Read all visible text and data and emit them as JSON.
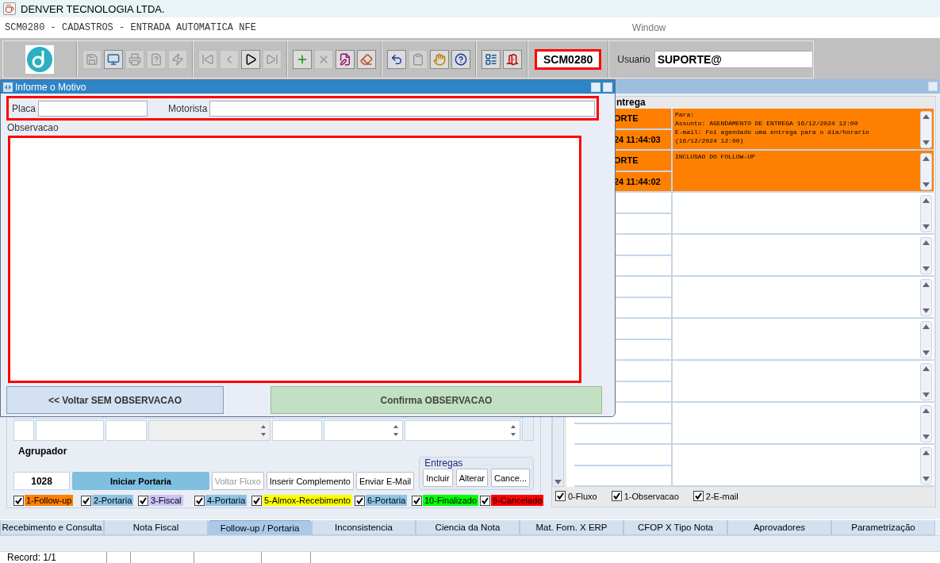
{
  "window": {
    "title": "DENVER TECNOLOGIA LTDA."
  },
  "menu_bar": {
    "title": "SCM0280 - CADASTROS - ENTRADA AUTOMATICA NFE",
    "window_menu": "Window"
  },
  "toolbar": {
    "groups": [
      [
        {
          "kind": "save",
          "disabled": true
        },
        {
          "kind": "window",
          "disabled": false
        },
        {
          "kind": "print",
          "disabled": true
        },
        {
          "kind": "query",
          "disabled": true
        },
        {
          "kind": "execute",
          "disabled": true
        }
      ],
      [
        {
          "kind": "first",
          "disabled": true
        },
        {
          "kind": "prev",
          "disabled": true
        },
        {
          "kind": "next",
          "disabled": false
        },
        {
          "kind": "last",
          "disabled": true
        }
      ],
      [
        {
          "kind": "insert",
          "disabled": false
        },
        {
          "kind": "delete",
          "disabled": true
        },
        {
          "kind": "edit",
          "disabled": false
        },
        {
          "kind": "clear",
          "disabled": false
        }
      ],
      [
        {
          "kind": "undo",
          "disabled": false
        },
        {
          "kind": "clipboard",
          "disabled": true
        },
        {
          "kind": "hand",
          "disabled": false
        },
        {
          "kind": "help",
          "disabled": false
        }
      ],
      [
        {
          "kind": "menu",
          "disabled": false
        },
        {
          "kind": "exit",
          "disabled": false
        }
      ]
    ],
    "screen_code": "SCM0280",
    "user_label": "Usuario",
    "user_value": "SUPORTE@"
  },
  "dialog": {
    "title": "Informe o Motivo",
    "placa_label": "Placa",
    "motorista_label": "Motorista",
    "observacao_label": "Observacao",
    "back_button": "<< Voltar SEM OBSERVACAO",
    "confirm_button": "Confirma OBSERVACAO"
  },
  "portaria": {
    "agrupador_label": "Agrupador",
    "agrupador_value": "1028",
    "buttons": [
      {
        "label": "Iniciar Portaria",
        "kind": "primary",
        "disabled": false
      },
      {
        "label": "Voltar Fluxo",
        "kind": "plain",
        "disabled": true
      },
      {
        "label": "Inserir Complemento",
        "kind": "plain",
        "disabled": false
      },
      {
        "label": "Enviar E-Mail",
        "kind": "plain",
        "disabled": false
      }
    ],
    "entregas": {
      "title": "Entregas",
      "buttons": [
        "Incluir",
        "Alterar",
        "Cance..."
      ]
    },
    "legend": [
      {
        "label": "1-Follow-up",
        "checked": true,
        "color": "#ff8000"
      },
      {
        "label": "2-Portaria",
        "checked": true,
        "color": "#8fc3e6"
      },
      {
        "label": "3-Fiscal",
        "checked": true,
        "color": "#c9c3f7"
      },
      {
        "label": "4-Portaria",
        "checked": true,
        "color": "#8fc3e6"
      },
      {
        "label": "5-Almox-Recebimento",
        "checked": true,
        "color": "#ffff00"
      },
      {
        "label": "6-Portaria",
        "checked": true,
        "color": "#8fc3e6"
      },
      {
        "label": "10-Finalizado",
        "checked": true,
        "color": "#00ff00"
      },
      {
        "label": "9-Cancelado",
        "checked": true,
        "color": "#ff0000"
      }
    ]
  },
  "entrega": {
    "title": "ntrega",
    "rows": [
      {
        "user": "ORTE",
        "datetime": "24 11:44:03",
        "message": [
          "Para:",
          "Assunto: AGENDAMENTO DE ENTREGA 16/12/2024 12:00",
          "E-mail: Foi agendado uma entrega para o dia/horario",
          "(16/12/2024 12:00)"
        ],
        "color": "#ff8000"
      },
      {
        "user": "ORTE",
        "datetime": "24 11:44:02",
        "message": [
          "INCLUSAO DO FOLLOW-UP"
        ],
        "color": "#ff8000"
      },
      {
        "color": "#ffffff"
      },
      {
        "color": "#ffffff"
      },
      {
        "color": "#ffffff"
      },
      {
        "color": "#ffffff"
      },
      {
        "color": "#ffffff"
      },
      {
        "color": "#ffffff"
      },
      {
        "color": "#ffffff"
      }
    ],
    "filters": [
      {
        "label": "0-Fluxo",
        "checked": true
      },
      {
        "label": "1-Observacao",
        "checked": true
      },
      {
        "label": "2-E-mail",
        "checked": true
      }
    ]
  },
  "tabs": [
    {
      "label": "Recebimento e Consulta",
      "selected": false
    },
    {
      "label": "Nota Fiscal",
      "selected": false
    },
    {
      "label": "Follow-up / Portaria",
      "selected": true
    },
    {
      "label": "Inconsistencia",
      "selected": false
    },
    {
      "label": "Ciencia da Nota",
      "selected": false
    },
    {
      "label": "Mat. Forn. X ERP",
      "selected": false
    },
    {
      "label": "CFOP X Tipo Nota",
      "selected": false
    },
    {
      "label": "Aprovadores",
      "selected": false
    },
    {
      "label": "Parametrização",
      "selected": false
    }
  ],
  "status_bar": {
    "record": "Record: 1/1"
  }
}
